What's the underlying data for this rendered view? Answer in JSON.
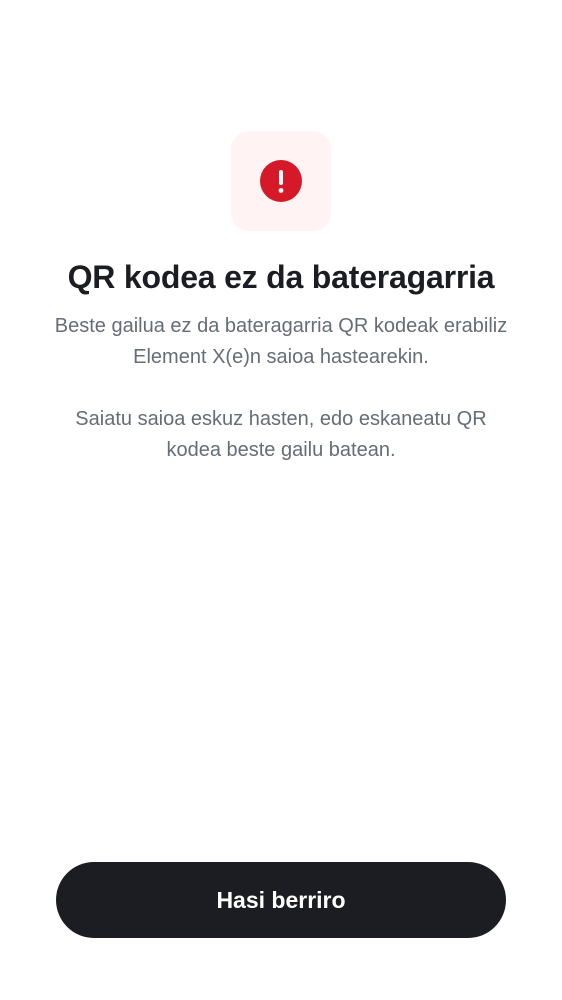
{
  "icon": {
    "name": "error-icon",
    "color": "#d51928",
    "tile_color": "#fff4f3"
  },
  "title": "QR kodea ez da bateragarria",
  "description": {
    "paragraph_1": "Beste gailua ez da bateragarria QR kodeak erabiliz Element X(e)n saioa hastearekin.",
    "paragraph_2": "Saiatu saioa eskuz hasten, edo eskaneatu QR kodea beste gailu batean."
  },
  "actions": {
    "restart_label": "Hasi berriro"
  },
  "colors": {
    "text_primary": "#1b1d22",
    "text_secondary": "#656d77",
    "button_background": "#1b1d22",
    "button_text": "#ffffff"
  }
}
